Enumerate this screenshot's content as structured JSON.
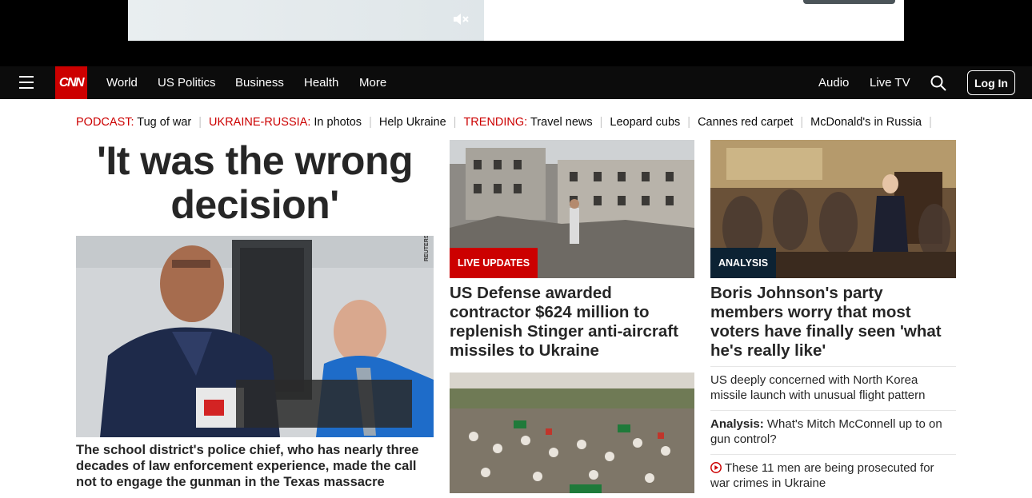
{
  "nav": {
    "logo": "CNN",
    "links": [
      "World",
      "US Politics",
      "Business",
      "Health",
      "More"
    ],
    "right_links": [
      "Audio",
      "Live TV"
    ],
    "login": "Log In"
  },
  "trending": [
    {
      "kicker": "PODCAST:",
      "text": "Tug of war"
    },
    {
      "kicker": "UKRAINE-RUSSIA:",
      "text": "In photos"
    },
    {
      "kicker": "",
      "text": "Help Ukraine"
    },
    {
      "kicker": "TRENDING:",
      "text": "Travel news"
    },
    {
      "kicker": "",
      "text": "Leopard cubs"
    },
    {
      "kicker": "",
      "text": "Cannes red carpet"
    },
    {
      "kicker": "",
      "text": "McDonald's in Russia"
    }
  ],
  "lead": {
    "headline": "'It was the wrong decision'",
    "photo_credit": "REUTERS",
    "caption": "The school district's police chief, who has nearly three decades of law enforcement experience, made the call not to engage the gunman in the Texas massacre"
  },
  "middle": {
    "badge": "LIVE UPDATES",
    "headline": "US Defense awarded contractor $624 million to replenish Stinger anti-aircraft missiles to Ukraine"
  },
  "right": {
    "badge": "ANALYSIS",
    "headline": "Boris Johnson's party members worry that most voters have finally seen 'what he's really like'",
    "items": [
      {
        "prefix": "",
        "text": "US deeply concerned with North Korea missile launch with unusual flight pattern",
        "icon": ""
      },
      {
        "prefix": "Analysis:",
        "text": " What's Mitch McConnell up to on gun control?",
        "icon": ""
      },
      {
        "prefix": "",
        "text": "These 11 men are being prosecuted for war crimes in Ukraine",
        "icon": "play-icon"
      }
    ]
  },
  "colors": {
    "brand": "#cc0000",
    "nav_bg": "#0c0c0c",
    "analysis_badge": "#0c2233"
  }
}
